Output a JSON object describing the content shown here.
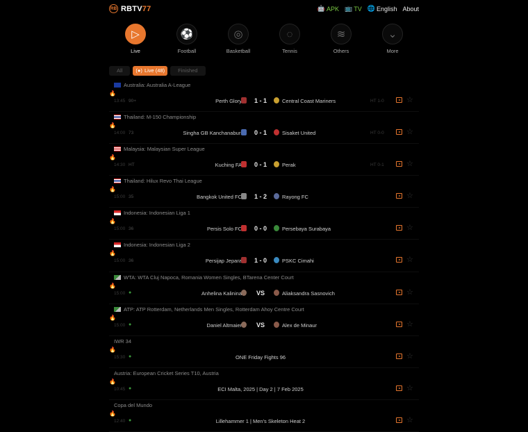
{
  "brand": {
    "badge": "RB",
    "name": "RBTV",
    "num": "77"
  },
  "topnav": {
    "apk": "APK",
    "tv": "TV",
    "lang": "English",
    "about": "About"
  },
  "sports": [
    {
      "label": "Live",
      "icon": "live-tv-icon",
      "glyph": "▷",
      "active": true
    },
    {
      "label": "Football",
      "icon": "football-icon",
      "glyph": "⚽",
      "active": false
    },
    {
      "label": "Basketball",
      "icon": "basketball-icon",
      "glyph": "◎",
      "active": false
    },
    {
      "label": "Tennis",
      "icon": "tennis-icon",
      "glyph": "◌",
      "active": false
    },
    {
      "label": "Others",
      "icon": "layers-icon",
      "glyph": "≋",
      "active": false
    },
    {
      "label": "More",
      "icon": "chevron-down-icon",
      "glyph": "⌄",
      "active": false
    }
  ],
  "tabs": {
    "all": "All",
    "live": "Live (48)",
    "finished": "Finished"
  },
  "colors": {
    "accent": "#e8772e",
    "live_dot": "#3c9a3c",
    "brand_green": "#7ac943"
  },
  "matches": [
    {
      "league": "Australia: Australia A-League",
      "flag": "au",
      "time": "13:45",
      "status": "90+",
      "home": "Perth Glory",
      "score": "1 - 1",
      "away": "Central Coast Mariners",
      "ht": "HT 1-0"
    },
    {
      "league": "Thailand: M-150 Championship",
      "flag": "th",
      "time": "14:00",
      "status": "73",
      "home": "Singha GB Kanchanaburi",
      "score": "0 - 1",
      "away": "Sisaket United",
      "ht": "HT 0-0"
    },
    {
      "league": "Malaysia: Malaysian Super League",
      "flag": "my",
      "time": "14:30",
      "status": "HT",
      "home": "Kuching FA",
      "score": "0 - 1",
      "away": "Perak",
      "ht": "HT 0-1"
    },
    {
      "league": "Thailand: Hilux Revo Thai League",
      "flag": "th",
      "time": "15:00",
      "status": "35",
      "home": "Bangkok United FC",
      "score": "1 - 2",
      "away": "Rayong FC",
      "ht": ""
    },
    {
      "league": "Indonesia: Indonesian Liga 1",
      "flag": "id",
      "time": "15:00",
      "status": "36",
      "home": "Persis Solo FC",
      "score": "0 - 0",
      "away": "Persebaya Surabaya",
      "ht": ""
    },
    {
      "league": "Indonesia: Indonesian Liga 2",
      "flag": "id",
      "time": "15:00",
      "status": "36",
      "home": "Persijap Jepara",
      "score": "1 - 0",
      "away": "PSKC Cimahi",
      "ht": ""
    },
    {
      "league": "WTA: WTA Cluj Napoca, Romania Women Singles, BTarena Center Court",
      "flag": "wta",
      "time": "15:00",
      "status": "●",
      "home": "Anhelina Kalinina",
      "score": "VS",
      "away": "Aliaksandra Sasnovich",
      "ht": ""
    },
    {
      "league": "ATP: ATP Rotterdam, Netherlands Men Singles, Rotterdam Ahoy Centre Court",
      "flag": "wta",
      "time": "15:00",
      "status": "●",
      "home": "Daniel Altmaier",
      "score": "VS",
      "away": "Alex de Minaur",
      "ht": ""
    },
    {
      "league": "IWR 34",
      "flag": "",
      "time": "15:30",
      "status": "●",
      "title": "ONE Friday Fights 96"
    },
    {
      "league": "Austria: European Cricket Series T10, Austria",
      "flag": "",
      "time": "10:45",
      "status": "●",
      "title": "ECI Malta, 2025 | Day 2 | 7 Feb 2025"
    },
    {
      "league": "Copa del Mundo",
      "flag": "",
      "time": "12:40",
      "status": "●",
      "title": "Lillehammer 1 | Men's Skeleton Heat 2"
    }
  ]
}
